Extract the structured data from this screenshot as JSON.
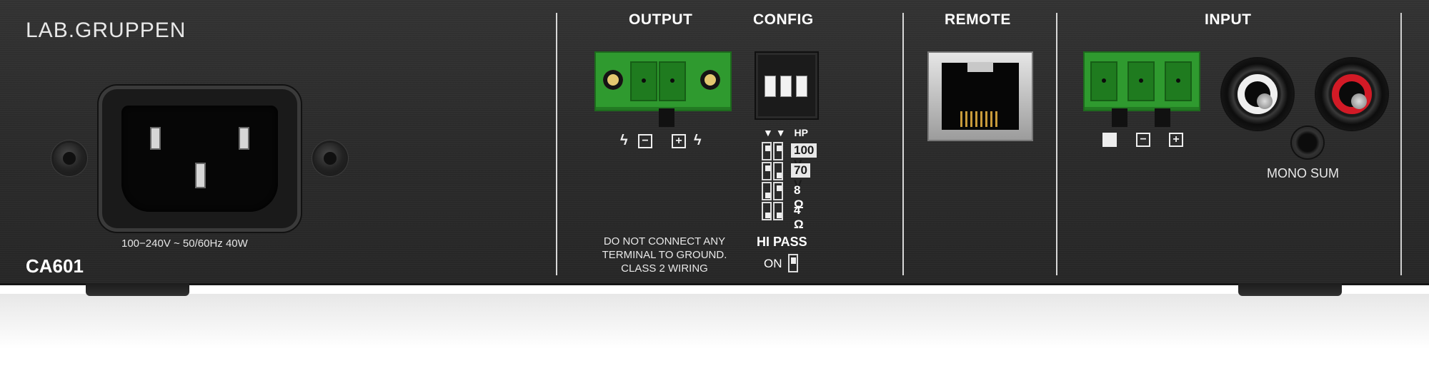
{
  "device": {
    "brand": "LAB.GRUPPEN",
    "model": "CA601",
    "power_rating": "100−240V ~ 50/60Hz 40W"
  },
  "sections": {
    "output": "OUTPUT",
    "config": "CONFIG",
    "remote": "REMOTE",
    "input": "INPUT"
  },
  "output": {
    "symbols": [
      "ϟ",
      "−",
      "+",
      "ϟ"
    ],
    "warning_lines": [
      "DO NOT CONNECT ANY",
      "TERMINAL TO GROUND.",
      "CLASS 2 WIRING"
    ]
  },
  "config": {
    "arrows": "▼ ▼",
    "hp_label": "HP",
    "modes": [
      {
        "label": "100 V",
        "highlighted": true
      },
      {
        "label": "70 V",
        "highlighted": true
      },
      {
        "label": "8 Ω",
        "highlighted": false
      },
      {
        "label": "4 Ω",
        "highlighted": false
      }
    ],
    "hipass_label": "HI PASS",
    "on_label": "ON"
  },
  "input": {
    "terminal_symbols": [
      "ground",
      "−",
      "+"
    ],
    "mono_sum_label": "MONO SUM"
  },
  "colors": {
    "panel": "#2b2b2b",
    "terminal_green": "#2f9a2f",
    "rca_white": "#efefef",
    "rca_red": "#d21a26"
  }
}
